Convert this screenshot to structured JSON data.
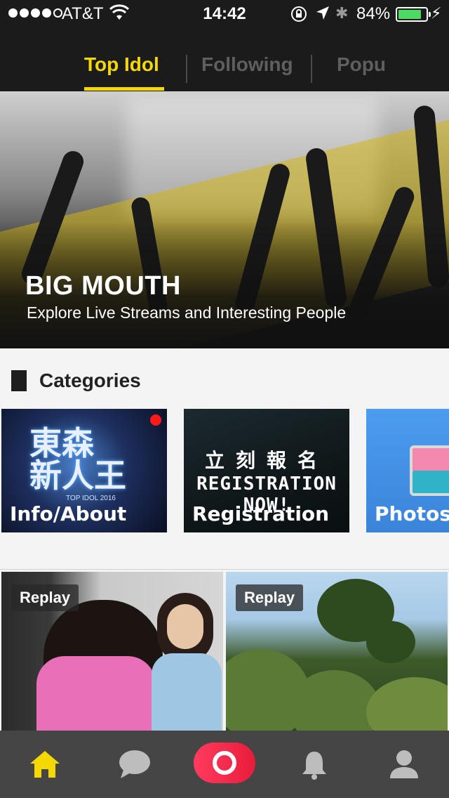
{
  "status_bar": {
    "carrier": "AT&T",
    "time": "14:42",
    "battery_percent": "84%",
    "battery_level": 0.84,
    "signal_bars_filled": 4,
    "signal_bars_total": 5,
    "icons": [
      "wifi-icon",
      "rotation-lock-icon",
      "location-icon",
      "bluetooth-icon",
      "battery-icon",
      "charging-icon"
    ]
  },
  "top_tabs": {
    "items": [
      {
        "label": "Top Idol",
        "active": true
      },
      {
        "label": "Following",
        "active": false
      },
      {
        "label": "Popu",
        "active": false
      }
    ],
    "active_color": "#f5d800",
    "inactive_color": "#5f5f5f"
  },
  "hero": {
    "title": "BIG MOUTH",
    "subtitle": "Explore Live Streams and Interesting People"
  },
  "categories": {
    "title": "Categories",
    "items": [
      {
        "label": "Info/About",
        "logo_text": "東森\n新人王",
        "logo_caption": "TOP IDOL 2016"
      },
      {
        "label": "Registration",
        "headline_cn": "立刻報名",
        "headline_en": "REGISTRATION NOW!"
      },
      {
        "label": "Photos",
        "icon": "photos-icon"
      }
    ]
  },
  "replays": [
    {
      "badge": "Replay"
    },
    {
      "badge": "Replay"
    }
  ],
  "bottom_nav": {
    "items": [
      "home-icon",
      "chat-icon",
      "live-icon",
      "bell-icon",
      "profile-icon"
    ],
    "active_color": "#f5d800",
    "inactive_color": "#bdbdbd"
  }
}
